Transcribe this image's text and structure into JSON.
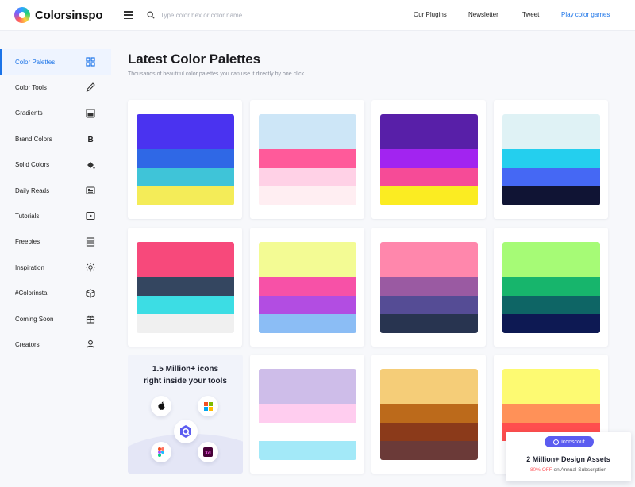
{
  "header": {
    "logo_text": "Colorsinspo",
    "search_placeholder": "Type color hex or color name",
    "nav": [
      "Our Plugins",
      "Newsletter",
      "Tweet",
      "Play color games"
    ]
  },
  "sidebar": {
    "items": [
      {
        "label": "Color Palettes",
        "icon": "grid-icon",
        "active": true
      },
      {
        "label": "Color Tools",
        "icon": "eyedropper-icon",
        "active": false
      },
      {
        "label": "Gradients",
        "icon": "image-icon",
        "active": false
      },
      {
        "label": "Brand Colors",
        "icon": "bold-b-icon",
        "active": false
      },
      {
        "label": "Solid Colors",
        "icon": "paint-bucket-icon",
        "active": false
      },
      {
        "label": "Daily Reads",
        "icon": "newspaper-icon",
        "active": false
      },
      {
        "label": "Tutorials",
        "icon": "play-icon",
        "active": false
      },
      {
        "label": "Freebies",
        "icon": "layers-icon",
        "active": false
      },
      {
        "label": "Inspiration",
        "icon": "sun-icon",
        "active": false
      },
      {
        "label": "#Colorinsta",
        "icon": "cube-icon",
        "active": false
      },
      {
        "label": "Coming Soon",
        "icon": "gift-icon",
        "active": false
      },
      {
        "label": "Creators",
        "icon": "user-icon",
        "active": false
      }
    ]
  },
  "main": {
    "title": "Latest Color Palettes",
    "subtitle": "Thousands of beautiful color palettes you can use it directly by one click."
  },
  "palettes": [
    {
      "colors": [
        "#4a33f0",
        "#2f68e6",
        "#3fc4d8",
        "#f4ec58"
      ]
    },
    {
      "colors": [
        "#cde6f7",
        "#ff5a9a",
        "#ffd1e6",
        "#ffeef2"
      ]
    },
    {
      "colors": [
        "#581fa8",
        "#a224f0",
        "#f64b97",
        "#fbec22"
      ]
    },
    {
      "colors": [
        "#dff2f5",
        "#24cfee",
        "#4568f4",
        "#101434"
      ]
    },
    {
      "colors": [
        "#f7497b",
        "#344660",
        "#3cdde4",
        "#f0f0f0"
      ]
    },
    {
      "colors": [
        "#f3fb94",
        "#f751a7",
        "#b24de2",
        "#8bbdf5"
      ]
    },
    {
      "colors": [
        "#ff87ac",
        "#9a5aa2",
        "#554c95",
        "#283450"
      ]
    },
    {
      "colors": [
        "#a6fb76",
        "#17b56c",
        "#0e6565",
        "#0d1953"
      ]
    },
    {
      "colors": [
        "#cebde9",
        "#ffcdef",
        "#ffffff",
        "#a3e9f8"
      ]
    },
    {
      "colors": [
        "#f5cd78",
        "#bc6a1b",
        "#8b3a1a",
        "#6b3a38"
      ]
    },
    {
      "colors": [
        "#fdfa72",
        "#ff9158",
        "#ff4e4e",
        "#ffffff"
      ]
    }
  ],
  "ads": {
    "icons_ad": {
      "title_line1": "1.5 Million+ icons",
      "title_line2": "right inside your tools"
    },
    "iconscout": {
      "logo": "iconscout",
      "title": "2 Million+ Design Assets",
      "discount": "80% OFF",
      "sub_rest": " on Annual Subscription"
    }
  }
}
